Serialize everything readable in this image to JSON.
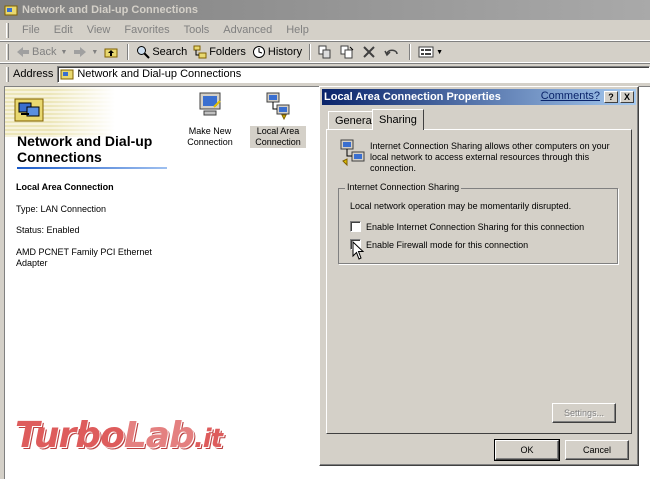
{
  "window": {
    "title": "Network and Dial-up Connections"
  },
  "menu": [
    "File",
    "Edit",
    "View",
    "Favorites",
    "Tools",
    "Advanced",
    "Help"
  ],
  "toolbar": {
    "back": "Back",
    "search": "Search",
    "folders": "Folders",
    "history": "History"
  },
  "address": {
    "label": "Address",
    "value": "Network and Dial-up Connections"
  },
  "leftpane": {
    "title": "Network and Dial-up Connections",
    "conn_name": "Local Area Connection",
    "type": "Type: LAN Connection",
    "status": "Status: Enabled",
    "adapter": "AMD PCNET Family PCI Ethernet Adapter"
  },
  "files": [
    {
      "label": "Make New Connection",
      "icon": "make-new-connection-icon"
    },
    {
      "label": "Local Area Connection",
      "icon": "local-area-connection-icon"
    }
  ],
  "watermark": {
    "text1": "Turbo",
    "text2": "Lab",
    "text3": ".it"
  },
  "dialog": {
    "title": "Local Area Connection Properties",
    "comments": "Comments?",
    "help_btn": "?",
    "close_btn": "X",
    "tabs": [
      "General",
      "Sharing"
    ],
    "active_tab": "Sharing",
    "description": "Internet Connection Sharing allows other computers on your local network to access external resources through this connection.",
    "group_title": "Internet Connection Sharing",
    "group_note": "Local network operation may be momentarily disrupted.",
    "checkbox_ics": "Enable Internet Connection Sharing for this connection",
    "checkbox_firewall": "Enable Firewall mode for this connection",
    "settings_btn": "Settings...",
    "ok_btn": "OK",
    "cancel_btn": "Cancel"
  }
}
